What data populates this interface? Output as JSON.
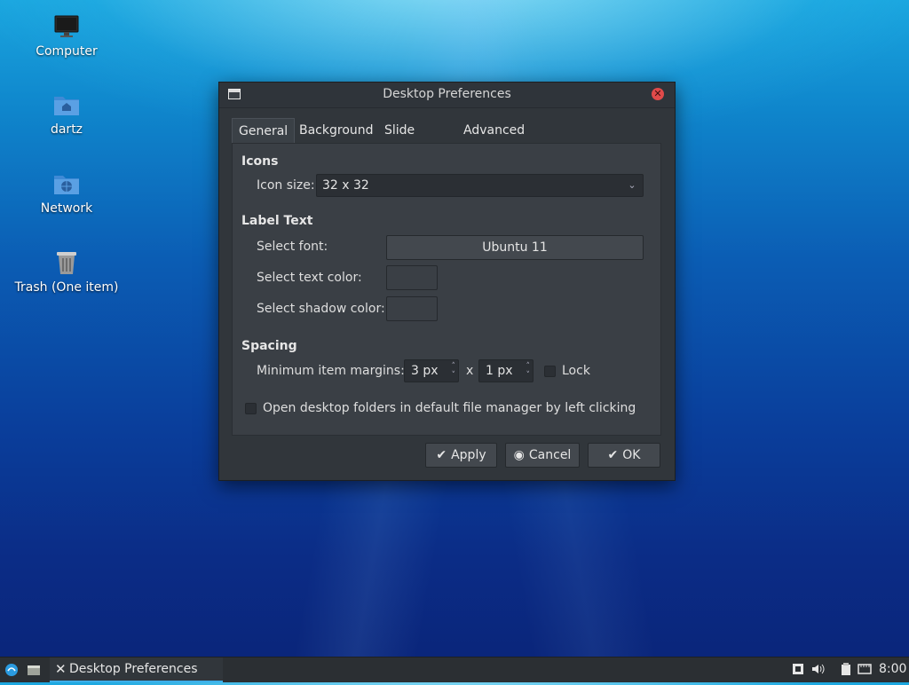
{
  "desktop": {
    "icons": [
      {
        "label": "Computer",
        "icon": "monitor-icon"
      },
      {
        "label": "dartz",
        "icon": "home-folder-icon"
      },
      {
        "label": "Network",
        "icon": "network-folder-icon"
      },
      {
        "label": "Trash (One item)",
        "icon": "trash-icon"
      }
    ]
  },
  "dialog": {
    "title": "Desktop Preferences",
    "tabs": [
      "General",
      "Background",
      "Slide Show",
      "Advanced"
    ],
    "active_tab": "General",
    "icons_section": {
      "heading": "Icons",
      "icon_size_label": "Icon size:",
      "icon_size_value": "32 x 32"
    },
    "label_text_section": {
      "heading": "Label Text",
      "font_label": "Select font:",
      "font_value": "Ubuntu 11",
      "text_color_label": "Select text color:",
      "shadow_color_label": "Select shadow color:",
      "text_color": "#3a3f45",
      "shadow_color": "#3a3f45"
    },
    "spacing_section": {
      "heading": "Spacing",
      "margins_label": "Minimum item margins:",
      "margin_x": "3 px",
      "separator": "x",
      "margin_y": "1 px",
      "lock_label": "Lock",
      "lock_checked": false
    },
    "open_folders_label": "Open desktop folders in default file manager by left clicking",
    "open_folders_checked": false,
    "buttons": {
      "apply": "Apply",
      "cancel": "Cancel",
      "ok": "OK"
    }
  },
  "taskbar": {
    "task_label": "Desktop Preferences",
    "clock": "8:00",
    "tray_icons": [
      "screenshot-icon",
      "volume-icon",
      "clipboard-icon",
      "network-icon"
    ]
  },
  "colors": {
    "accent": "#3daee9",
    "dialog_bg": "#31363b",
    "close_red": "#e04a4a"
  }
}
